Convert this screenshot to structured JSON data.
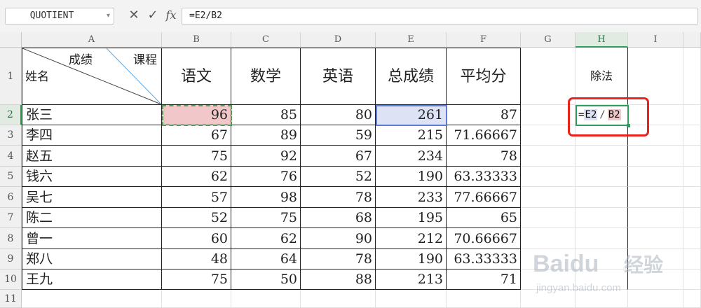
{
  "formula_bar": {
    "name_box": "QUOTIENT",
    "formula": "=E2/B2",
    "fx_label": "fx",
    "cancel_icon": "close-icon",
    "confirm_icon": "check-icon"
  },
  "columns": [
    "A",
    "B",
    "C",
    "D",
    "E",
    "F",
    "G",
    "H",
    "I"
  ],
  "rows": [
    "1",
    "2",
    "3",
    "4",
    "5",
    "6",
    "7",
    "8",
    "9",
    "10",
    "11"
  ],
  "header": {
    "diagonal_top": "课程",
    "diagonal_mid": "成绩",
    "diagonal_bottom": "姓名",
    "subjects": [
      "语文",
      "数学",
      "英语",
      "总成绩",
      "平均分"
    ],
    "h1": "除法"
  },
  "table_rows": [
    {
      "name": "张三",
      "chinese": "96",
      "math": "85",
      "english": "80",
      "total": "261",
      "avg": "87"
    },
    {
      "name": "李四",
      "chinese": "67",
      "math": "89",
      "english": "59",
      "total": "215",
      "avg": "71.66667"
    },
    {
      "name": "赵五",
      "chinese": "75",
      "math": "92",
      "english": "67",
      "total": "234",
      "avg": "78"
    },
    {
      "name": "钱六",
      "chinese": "62",
      "math": "76",
      "english": "52",
      "total": "190",
      "avg": "63.33333"
    },
    {
      "name": "吴七",
      "chinese": "57",
      "math": "98",
      "english": "78",
      "total": "233",
      "avg": "77.66667"
    },
    {
      "name": "陈二",
      "chinese": "52",
      "math": "75",
      "english": "68",
      "total": "195",
      "avg": "65"
    },
    {
      "name": "曾一",
      "chinese": "60",
      "math": "62",
      "english": "90",
      "total": "212",
      "avg": "70.66667"
    },
    {
      "name": "郑八",
      "chinese": "48",
      "math": "64",
      "english": "78",
      "total": "190",
      "avg": "63.33333"
    },
    {
      "name": "王九",
      "chinese": "75",
      "math": "50",
      "english": "88",
      "total": "213",
      "avg": "71"
    }
  ],
  "edit_cell": {
    "eq": "=",
    "ref1": "E2",
    "op": "/",
    "ref2": "B2"
  },
  "watermark": {
    "brand": "Baidu",
    "cn": "经验",
    "url": "jingyan.baidu.com"
  },
  "colors": {
    "accent_green": "#2e9e5a",
    "ref_blue": "#5b7bd5",
    "ref_red": "#c8696d",
    "annotation_red": "#e8231e"
  }
}
